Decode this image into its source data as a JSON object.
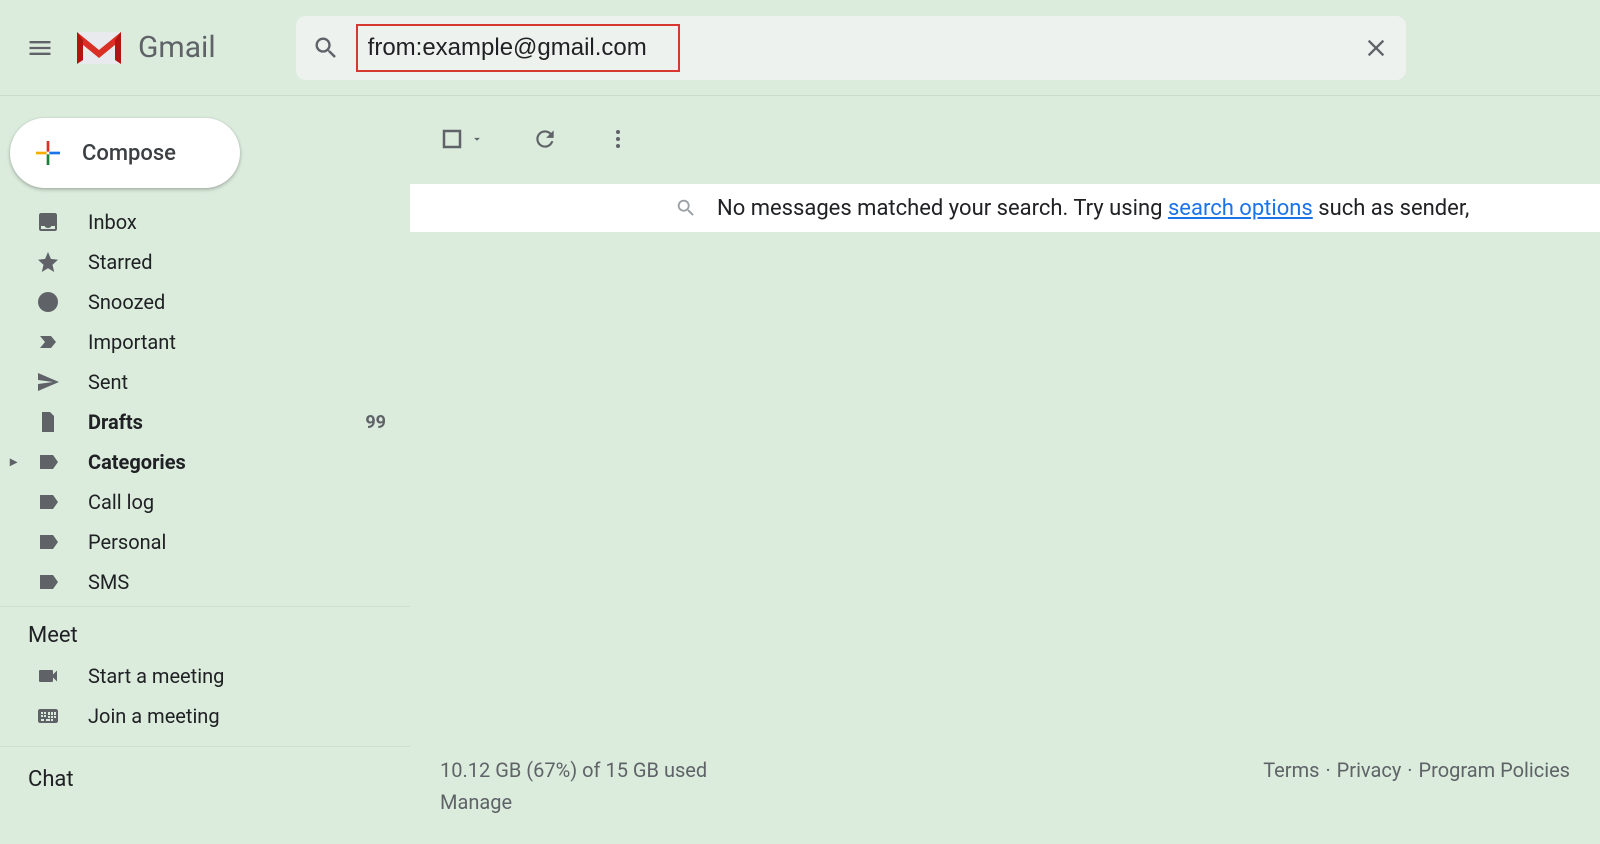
{
  "header": {
    "app_name": "Gmail",
    "search_value": "from:example@gmail.com"
  },
  "sidebar": {
    "compose_label": "Compose",
    "items": [
      {
        "label": "Inbox",
        "icon": "inbox",
        "bold": false
      },
      {
        "label": "Starred",
        "icon": "star",
        "bold": false
      },
      {
        "label": "Snoozed",
        "icon": "clock",
        "bold": false
      },
      {
        "label": "Important",
        "icon": "important",
        "bold": false
      },
      {
        "label": "Sent",
        "icon": "send",
        "bold": false
      },
      {
        "label": "Drafts",
        "icon": "file",
        "bold": true,
        "count": "99"
      },
      {
        "label": "Categories",
        "icon": "label",
        "bold": true,
        "expand": true
      },
      {
        "label": "Call log",
        "icon": "label",
        "bold": false
      },
      {
        "label": "Personal",
        "icon": "label",
        "bold": false
      },
      {
        "label": "SMS",
        "icon": "label",
        "bold": false
      }
    ],
    "meet": {
      "title": "Meet",
      "start": "Start a meeting",
      "join": "Join a meeting"
    },
    "chat_title": "Chat"
  },
  "main": {
    "empty": {
      "prefix": "No messages matched your search. Try using ",
      "link": "search options",
      "suffix": " such as sender,"
    }
  },
  "footer": {
    "storage": "10.12 GB (67%) of 15 GB used",
    "manage": "Manage",
    "links": [
      "Terms",
      "Privacy",
      "Program Policies"
    ]
  }
}
